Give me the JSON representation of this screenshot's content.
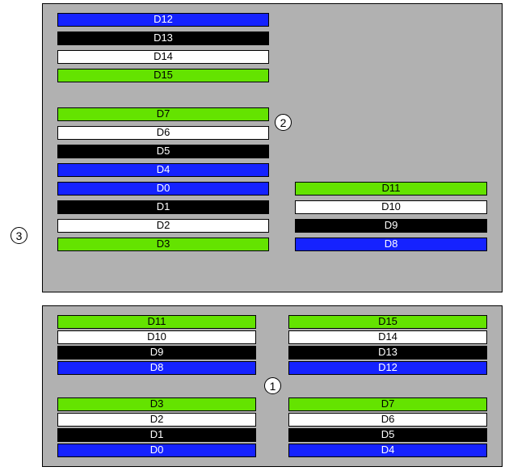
{
  "callouts": {
    "c1": "1",
    "c2": "2",
    "c3": "3"
  },
  "top": {
    "groupA": [
      {
        "label": "D12",
        "color": "blue"
      },
      {
        "label": "D13",
        "color": "black"
      },
      {
        "label": "D14",
        "color": "white"
      },
      {
        "label": "D15",
        "color": "green"
      }
    ],
    "groupB": [
      {
        "label": "D7",
        "color": "green"
      },
      {
        "label": "D6",
        "color": "white"
      },
      {
        "label": "D5",
        "color": "black"
      },
      {
        "label": "D4",
        "color": "blue"
      }
    ],
    "groupC": [
      {
        "label": "D0",
        "color": "blue"
      },
      {
        "label": "D1",
        "color": "black"
      },
      {
        "label": "D2",
        "color": "white"
      },
      {
        "label": "D3",
        "color": "green"
      }
    ],
    "groupD": [
      {
        "label": "D11",
        "color": "green"
      },
      {
        "label": "D10",
        "color": "white"
      },
      {
        "label": "D9",
        "color": "black"
      },
      {
        "label": "D8",
        "color": "blue"
      }
    ]
  },
  "bottom": {
    "topLeft": [
      {
        "label": "D11",
        "color": "green"
      },
      {
        "label": "D10",
        "color": "white"
      },
      {
        "label": "D9",
        "color": "black"
      },
      {
        "label": "D8",
        "color": "blue"
      }
    ],
    "topRight": [
      {
        "label": "D15",
        "color": "green"
      },
      {
        "label": "D14",
        "color": "white"
      },
      {
        "label": "D13",
        "color": "black"
      },
      {
        "label": "D12",
        "color": "blue"
      }
    ],
    "botLeft": [
      {
        "label": "D3",
        "color": "green"
      },
      {
        "label": "D2",
        "color": "white"
      },
      {
        "label": "D1",
        "color": "black"
      },
      {
        "label": "D0",
        "color": "blue"
      }
    ],
    "botRight": [
      {
        "label": "D7",
        "color": "green"
      },
      {
        "label": "D6",
        "color": "white"
      },
      {
        "label": "D5",
        "color": "black"
      },
      {
        "label": "D4",
        "color": "blue"
      }
    ]
  }
}
